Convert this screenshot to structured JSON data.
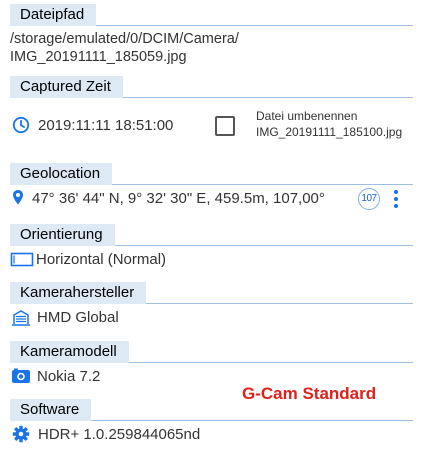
{
  "sections": {
    "path": {
      "title": "Dateipfad",
      "line1": "/storage/emulated/0/DCIM/Camera/",
      "line2": "IMG_20191111_185059.jpg"
    },
    "captured": {
      "title": "Captured Zeit",
      "value": "2019:11:11 18:51:00",
      "icon": "clock-icon",
      "rename_label": "Datei umbenennen",
      "rename_value": "IMG_20191111_185100.jpg",
      "checked": false
    },
    "geo": {
      "title": "Geolocation",
      "value": "47° 36' 44\" N, 9° 32' 30\" E,  459.5m, 107,00°",
      "icon": "location-pin-icon",
      "badge": "107",
      "menu_icon": "more-vert-icon"
    },
    "orientation": {
      "title": "Orientierung",
      "value": "Horizontal (Normal)",
      "icon": "landscape-icon"
    },
    "maker": {
      "title": "Kamerahersteller",
      "value": "HMD Global",
      "icon": "building-icon"
    },
    "model": {
      "title": "Kameramodell",
      "value": "Nokia 7.2",
      "icon": "camera-icon"
    },
    "software": {
      "title": "Software",
      "value": "HDR+ 1.0.259844065nd",
      "icon": "gear-icon"
    }
  },
  "watermark": "G-Cam Standard",
  "colors": {
    "header_bg": "#ddeaf6",
    "icon_blue": "#1a73e8",
    "rule": "#9dbfe1",
    "watermark": "#e0201b"
  }
}
